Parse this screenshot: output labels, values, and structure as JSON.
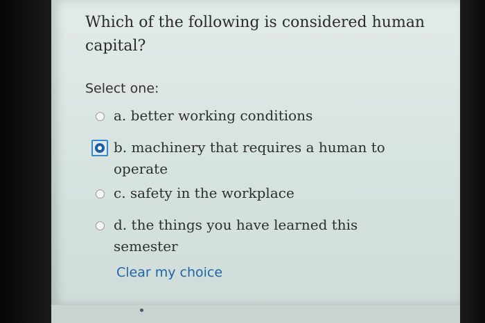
{
  "question": {
    "text": "Which of the following is considered human capital?",
    "prompt": "Select one:"
  },
  "options": [
    {
      "letter": "a.",
      "text": "better working conditions",
      "selected": false
    },
    {
      "letter": "b.",
      "text": "machinery that requires a human to operate",
      "selected": true
    },
    {
      "letter": "c.",
      "text": "safety in the workplace",
      "selected": false
    },
    {
      "letter": "d.",
      "text": "the things you have learned this semester",
      "selected": false
    }
  ],
  "actions": {
    "clear_label": "Clear my choice"
  },
  "colors": {
    "selected_radio": "#1c5fa7",
    "selected_border": "#3a87c6",
    "link": "#1f66a8"
  }
}
